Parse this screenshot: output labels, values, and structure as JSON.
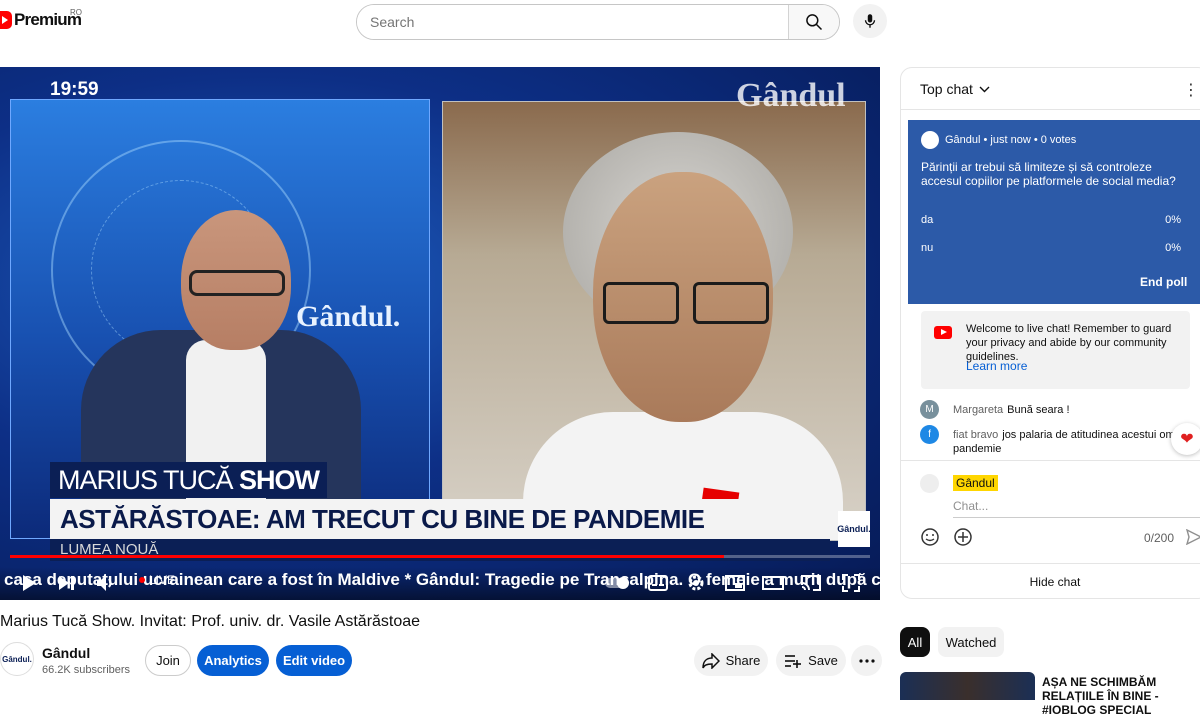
{
  "header": {
    "logo_text": "Premium",
    "country_code": "RO",
    "search_placeholder": "Search"
  },
  "player": {
    "clock": "19:59",
    "watermark": "Gândul",
    "wall_logo": "Gândul.",
    "show_name_light": "MARIUS TUCĂ ",
    "show_name_bold": "SHOW",
    "headline": "ASTĂRĂSTOAE: AM TRECUT CU BINE DE PANDEMIE",
    "subline": "LUMEA NOUĂ",
    "mini_logo": "Gândul.",
    "live_label": "LIVE",
    "ticker": "casa deputatului ucrainean care a fost în Maldive * Gândul: Tragedie pe Transalpina. O femeie a murit după ce un c",
    "progress_fraction": 0.83
  },
  "video": {
    "title": "Marius Tucă Show. Invitat: Prof. univ. dr. Vasile Astărăstoae",
    "channel": {
      "avatar_text": "Gândul.",
      "name": "Gândul",
      "subscribers": "66.2K subscribers"
    },
    "buttons": {
      "join": "Join",
      "analytics": "Analytics",
      "edit": "Edit video",
      "share": "Share",
      "save": "Save"
    }
  },
  "chat": {
    "mode_label": "Top chat",
    "poll": {
      "meta": "Gândul • just now • 0 votes",
      "question": "Părinții ar trebui să limiteze și să controleze accesul copiilor pe platformele de social media?",
      "options": [
        {
          "label": "da",
          "percent": "0%"
        },
        {
          "label": "nu",
          "percent": "0%"
        }
      ],
      "end_label": "End poll"
    },
    "welcome": {
      "text": "Welcome to live chat! Remember to guard your privacy and abide by our community guidelines.",
      "link": "Learn more"
    },
    "messages": [
      {
        "initial": "M",
        "author": "Margareta",
        "text": "Bună seara !",
        "color": "#78909c"
      },
      {
        "initial": "f",
        "author": "fiat bravo",
        "text": "jos palaria de atitudinea acestui om pandemie",
        "color": "#1e88e5"
      }
    ],
    "composer": {
      "user": "Gândul",
      "placeholder": "Chat...",
      "counter": "0/200"
    },
    "hide_label": "Hide chat"
  },
  "recommendations": {
    "chips": [
      "All",
      "Watched"
    ],
    "first_title": "AȘA NE SCHIMBĂM RELAȚIILE ÎN BINE - #IOBLOG SPECIAL"
  },
  "colors": {
    "accent_blue": "#065fd4",
    "youtube_red": "#ff0000",
    "poll_bg": "#2c5aa8"
  }
}
